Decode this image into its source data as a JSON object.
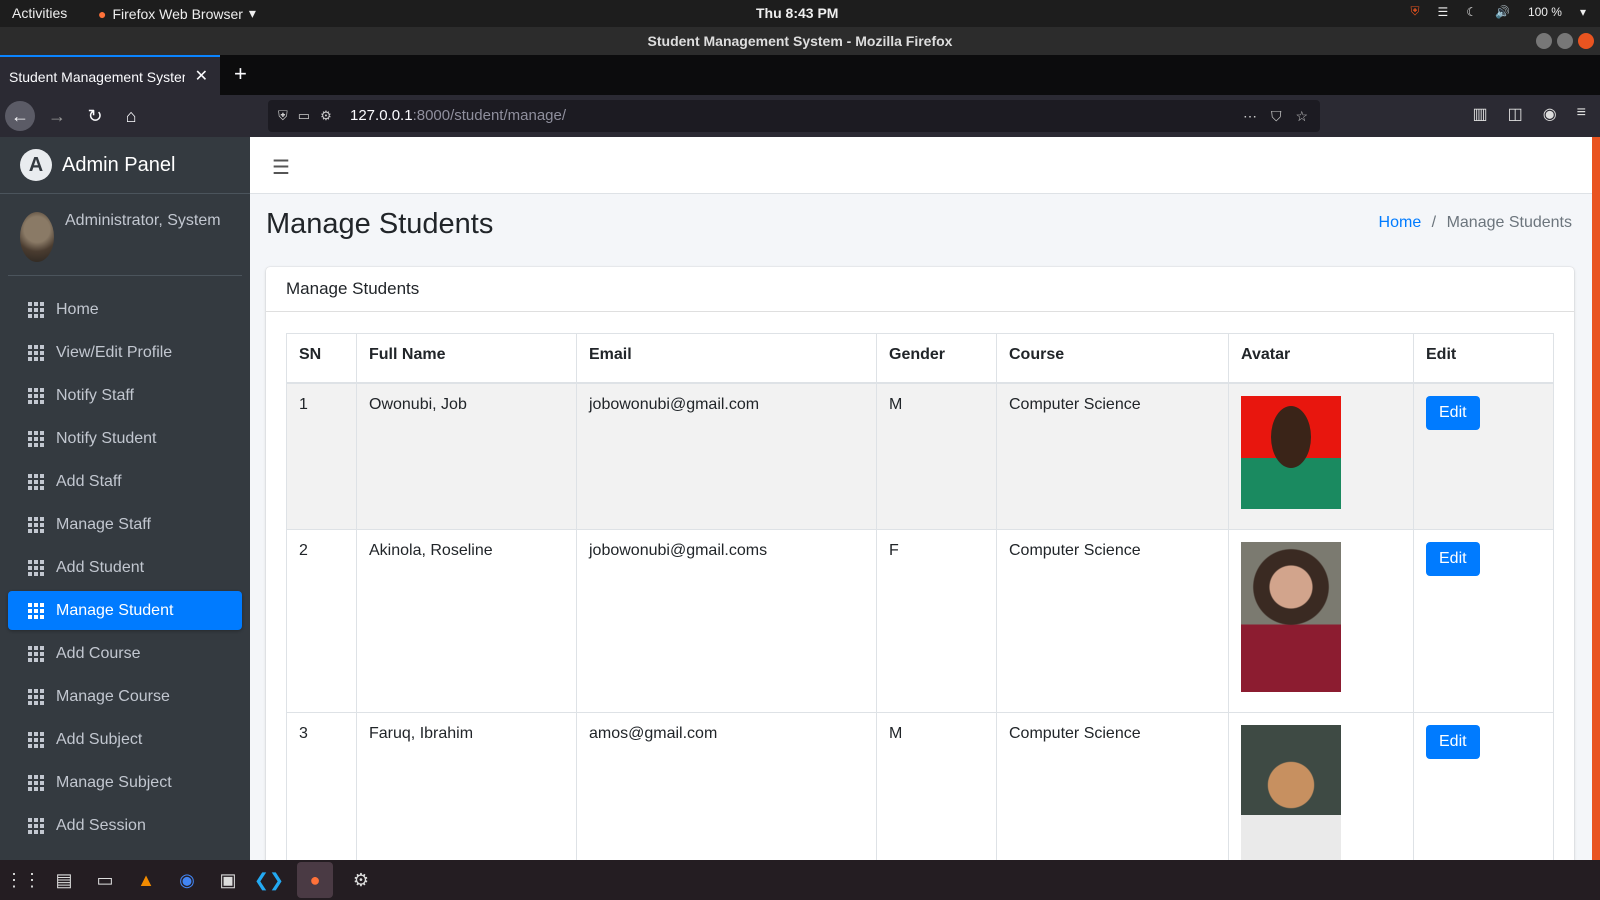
{
  "system": {
    "activities": "Activities",
    "app_name": "Firefox Web Browser",
    "clock": "Thu  8:43 PM",
    "battery": "100 %",
    "window_title": "Student Management System - Mozilla Firefox"
  },
  "browser": {
    "tab_title": "Student Management System",
    "url_host": "127.0.0.1",
    "url_path": ":8000/student/manage/"
  },
  "sidebar": {
    "brand": "Admin Panel",
    "brand_letter": "A",
    "user_name": "Administrator, System",
    "items": [
      {
        "label": "Home"
      },
      {
        "label": "View/Edit Profile"
      },
      {
        "label": "Notify Staff"
      },
      {
        "label": "Notify Student"
      },
      {
        "label": "Add Staff"
      },
      {
        "label": "Manage Staff"
      },
      {
        "label": "Add Student"
      },
      {
        "label": "Manage Student"
      },
      {
        "label": "Add Course"
      },
      {
        "label": "Manage Course"
      },
      {
        "label": "Add Subject"
      },
      {
        "label": "Manage Subject"
      },
      {
        "label": "Add Session"
      }
    ],
    "active_item": "Manage Student"
  },
  "page": {
    "title": "Manage Students",
    "breadcrumb_home": "Home",
    "breadcrumb_sep": "/",
    "breadcrumb_current": "Manage Students",
    "card_title": "Manage Students"
  },
  "table": {
    "headers": [
      "SN",
      "Full Name",
      "Email",
      "Gender",
      "Course",
      "Avatar",
      "Edit"
    ],
    "rows": [
      {
        "sn": "1",
        "name": "Owonubi, Job",
        "email": "jobowonubi@gmail.com",
        "gender": "M",
        "course": "Computer Science",
        "edit": "Edit"
      },
      {
        "sn": "2",
        "name": "Akinola, Roseline",
        "email": "jobowonubi@gmail.coms",
        "gender": "F",
        "course": "Computer Science",
        "edit": "Edit"
      },
      {
        "sn": "3",
        "name": "Faruq, Ibrahim",
        "email": "amos@gmail.com",
        "gender": "M",
        "course": "Computer Science",
        "edit": "Edit"
      }
    ]
  },
  "colors": {
    "primary": "#007bff",
    "sidebar_bg": "#343a40",
    "content_bg": "#f4f6f9"
  }
}
